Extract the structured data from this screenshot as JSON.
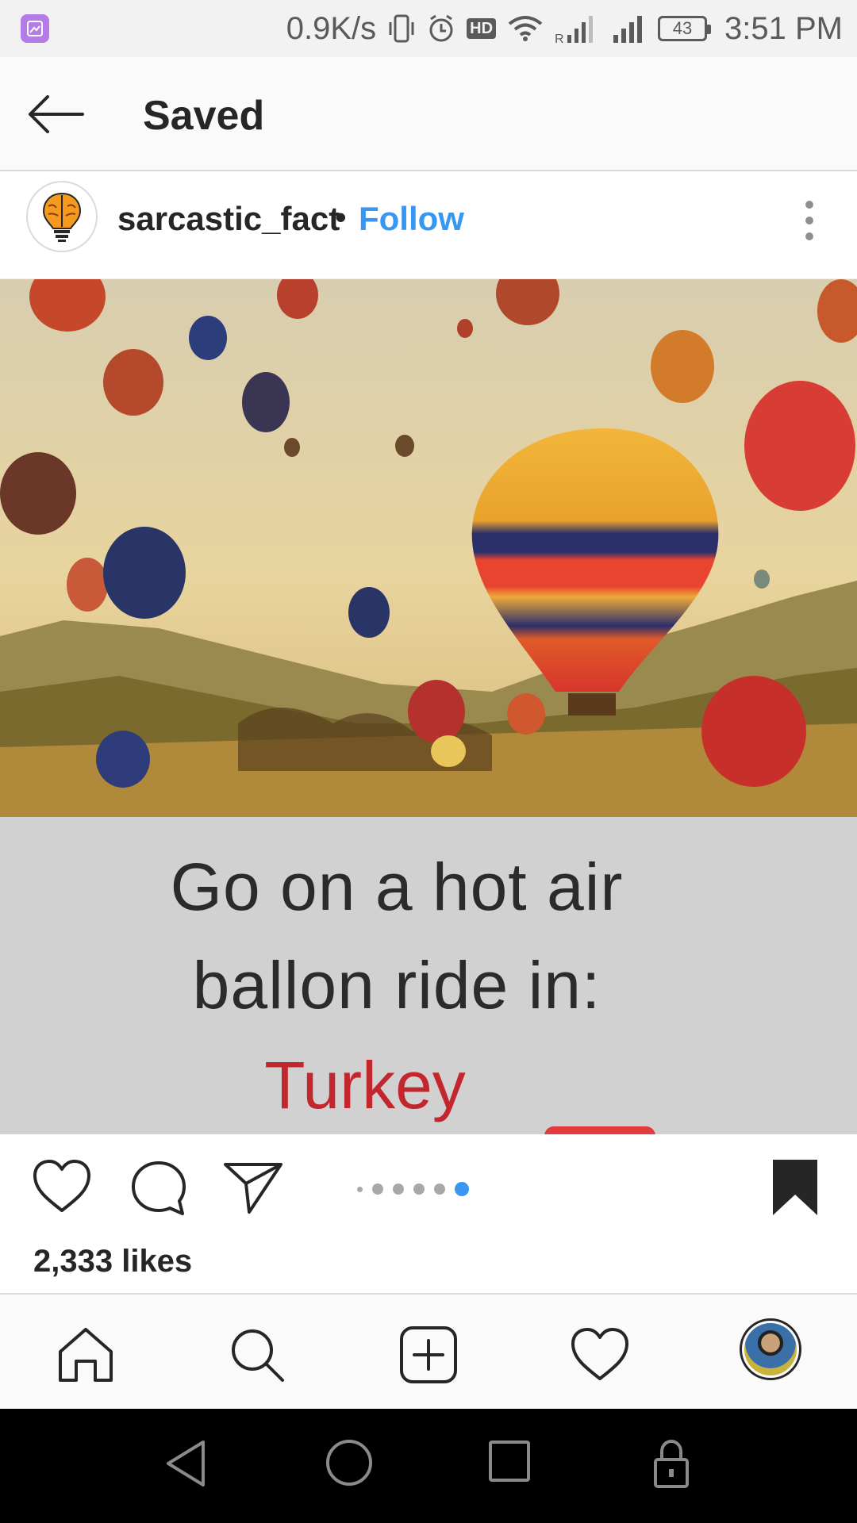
{
  "status_bar": {
    "net_speed": "0.9K/s",
    "hd": "HD",
    "battery_level": "43",
    "time": "3:51 PM",
    "icons": [
      "gallery-icon",
      "vibrate-icon",
      "alarm-icon",
      "wifi-icon",
      "signal-r-icon",
      "signal-icon",
      "battery-icon"
    ]
  },
  "header": {
    "title": "Saved",
    "back_icon": "arrow-left-icon"
  },
  "post": {
    "username": "sarcastic_fact",
    "separator": "•",
    "follow_label": "Follow",
    "image_caption": {
      "line1": "Go on a hot air",
      "line2": "ballon ride in:",
      "country": "Turkey"
    },
    "carousel": {
      "count": 6,
      "active_index": 5
    },
    "likes": "2,333 likes",
    "saved": true
  },
  "bottom_nav": {
    "items": [
      "home-icon",
      "search-icon",
      "add-post-icon",
      "heart-icon",
      "profile-avatar"
    ]
  },
  "colors": {
    "accent": "#3897f0",
    "text": "#262626",
    "caption_red": "#c2272d",
    "caption_panel": "#d1d1d1"
  }
}
